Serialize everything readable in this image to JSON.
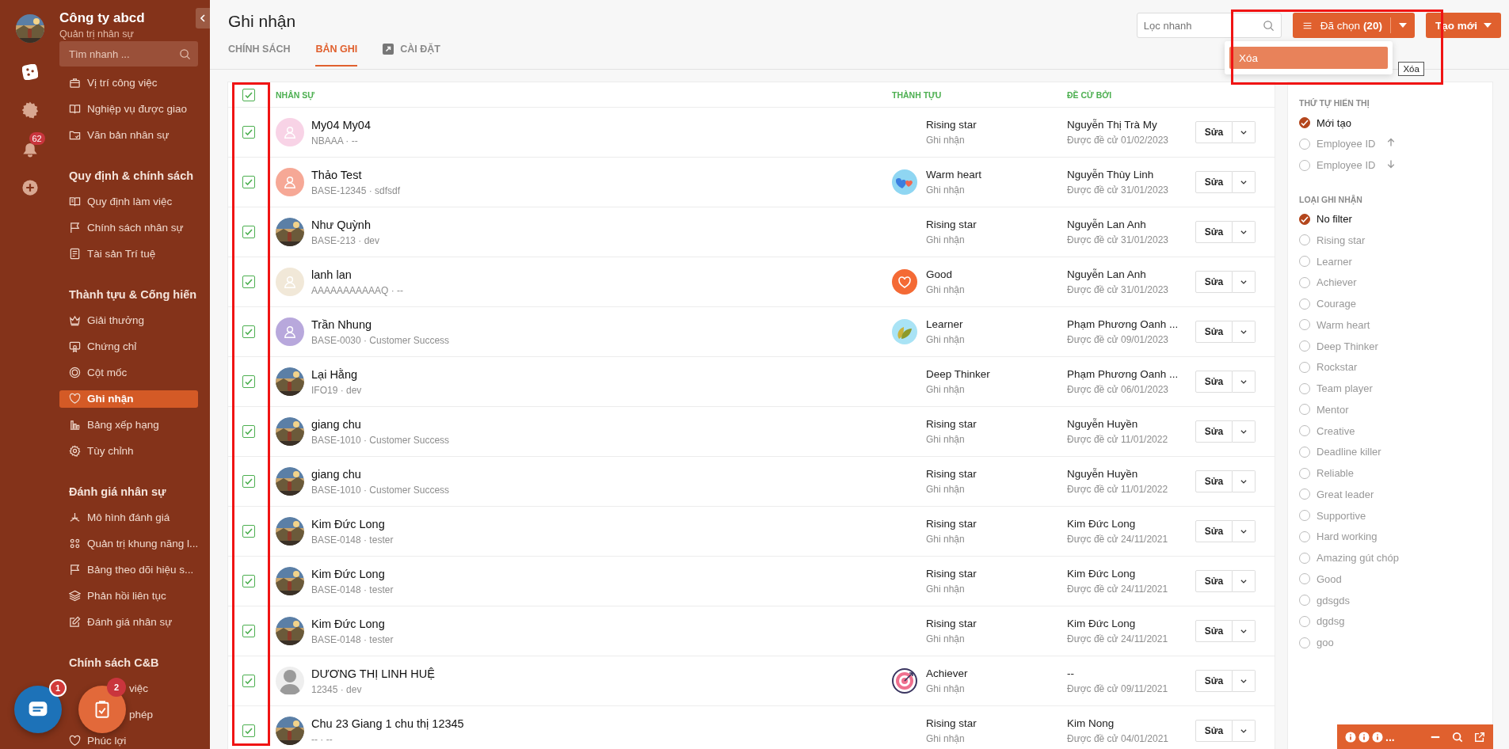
{
  "rail": {
    "notification_badge": "62"
  },
  "sidebar": {
    "company": "Công ty abcd",
    "subtitle": "Quản trị nhân sự",
    "search": {
      "placeholder": "Tìm nhanh ..."
    },
    "groups": [
      {
        "items": [
          {
            "label": "Vị trí công việc",
            "selected": false
          },
          {
            "label": "Nghiệp vụ được giao",
            "selected": false
          },
          {
            "label": "Văn bản nhân sự",
            "selected": false
          }
        ]
      },
      {
        "title": "Quy định & chính sách",
        "items": [
          {
            "label": "Quy định làm việc",
            "selected": false
          },
          {
            "label": "Chính sách nhân sự",
            "selected": false
          },
          {
            "label": "Tài sản Trí tuệ",
            "selected": false
          }
        ]
      },
      {
        "title": "Thành tựu & Cống hiến",
        "items": [
          {
            "label": "Giải thưởng",
            "selected": false
          },
          {
            "label": "Chứng chỉ",
            "selected": false
          },
          {
            "label": "Cột mốc",
            "selected": false
          },
          {
            "label": "Ghi nhận",
            "selected": true
          },
          {
            "label": "Bảng xếp hạng",
            "selected": false
          },
          {
            "label": "Tùy chỉnh",
            "selected": false
          }
        ]
      },
      {
        "title": "Đánh giá nhân sự",
        "items": [
          {
            "label": "Mô hình đánh giá",
            "selected": false
          },
          {
            "label": "Quản trị khung năng l...",
            "selected": false
          },
          {
            "label": "Bảng theo dõi hiệu s...",
            "selected": false
          },
          {
            "label": "Phản hồi liên tục",
            "selected": false
          },
          {
            "label": "Đánh giá nhân sự",
            "selected": false
          }
        ]
      },
      {
        "title": "Chính sách C&B",
        "items": [
          {
            "label": "việc",
            "selected": false,
            "kind": "covered"
          },
          {
            "label": "phép",
            "selected": false,
            "kind": "covered"
          },
          {
            "label": "Phúc lợi",
            "selected": false
          }
        ]
      }
    ]
  },
  "floating": {
    "chat_badge": "1",
    "tasks_badge": "2"
  },
  "header": {
    "title": "Ghi nhận",
    "tabs": [
      {
        "label": "CHÍNH SÁCH",
        "selected": false
      },
      {
        "label": "BẢN GHI",
        "selected": true
      },
      {
        "label": "CÀI ĐẶT",
        "selected": false,
        "kind": "external"
      }
    ],
    "search": {
      "placeholder": "Lọc nhanh"
    },
    "selected_button": "Đã chọn **(20)**",
    "create_button": "Tạo mới",
    "menu": [
      {
        "label": "Xóa",
        "selected": true
      }
    ],
    "tooltip": "Xóa"
  },
  "table": {
    "header_checked": true,
    "columns": [
      "NHÂN SỰ",
      "THÀNH TỰU",
      "ĐỀ CỬ BỞI"
    ],
    "rows": [
      {
        "checked": true,
        "avatar": {
          "kind": "placeholder",
          "color": "#f8d3e6"
        },
        "name": "My04 My04",
        "meta": "NBAAA · --",
        "achievement": "Rising star",
        "type": "Ghi nhận",
        "nominator": "Nguyễn Thị Trà My",
        "date": "Được đề cử 01/02/2023",
        "edit": "Sửa"
      },
      {
        "checked": true,
        "avatar": {
          "kind": "placeholder",
          "color": "#f6a896"
        },
        "icon": {
          "kind": "hearts"
        },
        "name": "Thảo Test",
        "meta": "BASE-12345 · sdfsdf",
        "achievement": "Warm heart",
        "type": "Ghi nhận",
        "nominator": "Nguyễn Thùy Linh",
        "date": "Được đề cử 31/01/2023",
        "edit": "Sửa"
      },
      {
        "checked": true,
        "name": "Như Quỳnh",
        "meta": "BASE-213 · dev",
        "achievement": "Rising star",
        "type": "Ghi nhận",
        "nominator": "Nguyễn Lan Anh",
        "date": "Được đề cử 31/01/2023",
        "edit": "Sửa"
      },
      {
        "checked": true,
        "avatar": {
          "kind": "placeholder",
          "color": "#f1e8d8"
        },
        "icon": {
          "kind": "heart"
        },
        "name": "lanh lan",
        "meta": "AAAAAAAAAAAQ · --",
        "achievement": "Good",
        "type": "Ghi nhận",
        "nominator": "Nguyễn Lan Anh",
        "date": "Được đề cử 31/01/2023",
        "edit": "Sửa"
      },
      {
        "checked": true,
        "avatar": {
          "kind": "placeholder",
          "color": "#b8a8dc"
        },
        "icon": {
          "kind": "leaf"
        },
        "name": "Trần Nhung",
        "meta": "BASE-0030 · Customer Success",
        "achievement": "Learner",
        "type": "Ghi nhận",
        "nominator": "Phạm Phương Oanh ...",
        "date": "Được đề cử 09/01/2023",
        "edit": "Sửa"
      },
      {
        "checked": true,
        "name": "Lại Hằng",
        "meta": "IFO19 · dev",
        "achievement": "Deep Thinker",
        "type": "Ghi nhận",
        "nominator": "Phạm Phương Oanh ...",
        "date": "Được đề cử 06/01/2023",
        "edit": "Sửa"
      },
      {
        "checked": true,
        "name": "giang chu",
        "meta": "BASE-1010 · Customer Success",
        "achievement": "Rising star",
        "type": "Ghi nhận",
        "nominator": "Nguyễn Huyền",
        "date": "Được đề cử 11/01/2022",
        "edit": "Sửa"
      },
      {
        "checked": true,
        "name": "giang chu",
        "meta": "BASE-1010 · Customer Success",
        "achievement": "Rising star",
        "type": "Ghi nhận",
        "nominator": "Nguyễn Huyền",
        "date": "Được đề cử 11/01/2022",
        "edit": "Sửa"
      },
      {
        "checked": true,
        "name": "Kim Đức Long",
        "meta": "BASE-0148 · tester",
        "achievement": "Rising star",
        "type": "Ghi nhận",
        "nominator": "Kim Đức Long",
        "date": "Được đề cử 24/11/2021",
        "edit": "Sửa"
      },
      {
        "checked": true,
        "name": "Kim Đức Long",
        "meta": "BASE-0148 · tester",
        "achievement": "Rising star",
        "type": "Ghi nhận",
        "nominator": "Kim Đức Long",
        "date": "Được đề cử 24/11/2021",
        "edit": "Sửa"
      },
      {
        "checked": true,
        "name": "Kim Đức Long",
        "meta": "BASE-0148 · tester",
        "achievement": "Rising star",
        "type": "Ghi nhận",
        "nominator": "Kim Đức Long",
        "date": "Được đề cử 24/11/2021",
        "edit": "Sửa"
      },
      {
        "checked": true,
        "avatar": {
          "kind": "silhouette"
        },
        "icon": {
          "kind": "target"
        },
        "name": "DƯƠNG THỊ LINH HUỆ",
        "meta": "12345 · dev",
        "achievement": "Achiever",
        "type": "Ghi nhận",
        "nominator": "--",
        "date": "Được đề cử 09/11/2021",
        "edit": "Sửa"
      },
      {
        "checked": true,
        "name": "Chu 23 Giang 1 chu thị 12345",
        "meta": "-- · --",
        "achievement": "Rising star",
        "type": "Ghi nhận",
        "nominator": "Kim Nong",
        "date": "Được đề cử 04/01/2021",
        "edit": "Sửa"
      }
    ]
  },
  "filters": [
    {
      "title": "THỨ TỰ HIỂN THỊ",
      "options": [
        {
          "label": "Mới tạo",
          "selected": true
        },
        {
          "label": "Employee ID",
          "selected": false,
          "kind": "asc"
        },
        {
          "label": "Employee ID",
          "selected": false,
          "kind": "desc"
        }
      ]
    },
    {
      "title": "LOẠI GHI NHẬN",
      "options": [
        {
          "label": "No filter",
          "selected": true
        },
        {
          "label": "Rising star",
          "selected": false
        },
        {
          "label": "Learner",
          "selected": false
        },
        {
          "label": "Achiever",
          "selected": false
        },
        {
          "label": "Courage",
          "selected": false
        },
        {
          "label": "Warm heart",
          "selected": false
        },
        {
          "label": "Deep Thinker",
          "selected": false
        },
        {
          "label": "Rockstar",
          "selected": false
        },
        {
          "label": "Team player",
          "selected": false
        },
        {
          "label": "Mentor",
          "selected": false
        },
        {
          "label": "Creative",
          "selected": false
        },
        {
          "label": "Deadline killer",
          "selected": false
        },
        {
          "label": "Reliable",
          "selected": false
        },
        {
          "label": "Great leader",
          "selected": false
        },
        {
          "label": "Supportive",
          "selected": false
        },
        {
          "label": "Hard working",
          "selected": false
        },
        {
          "label": "Amazing gút chóp",
          "selected": false
        },
        {
          "label": "Good",
          "selected": false
        },
        {
          "label": "gdsgds",
          "selected": false
        },
        {
          "label": "dgdsg",
          "selected": false
        },
        {
          "label": "goo",
          "selected": false
        }
      ]
    }
  ],
  "mini_bar": {
    "label": "..."
  }
}
